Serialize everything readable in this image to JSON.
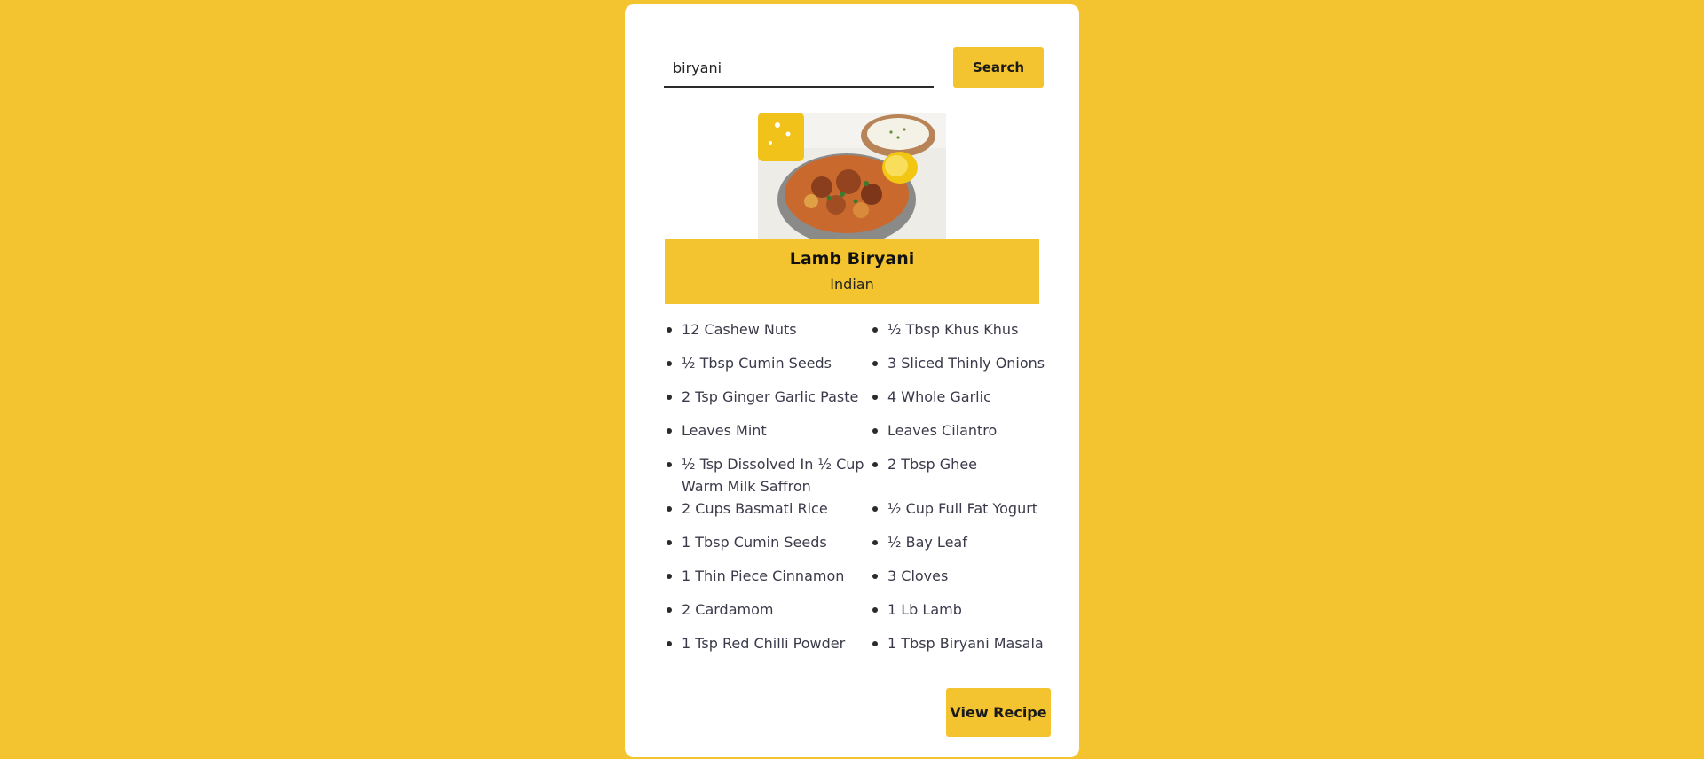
{
  "search": {
    "value": "biryani",
    "button_label": "Search"
  },
  "meal": {
    "image_alt": "Lamb Biryani dish photo",
    "title": "Lamb Biryani",
    "area": "Indian"
  },
  "ingredients": [
    "12 Cashew Nuts",
    "½ Tbsp Khus Khus",
    "½ Tbsp Cumin Seeds",
    "3 Sliced Thinly Onions",
    "2 Tsp Ginger Garlic Paste",
    "4 Whole Garlic",
    "Leaves Mint",
    "Leaves Cilantro",
    "½ Tsp Dissolved In ½ Cup Warm Milk Saffron",
    "2 Tbsp Ghee",
    "2 Cups Basmati Rice",
    "½ Cup Full Fat Yogurt",
    "1 Tbsp Cumin Seeds",
    "½ Bay Leaf",
    "1 Thin Piece Cinnamon",
    "3 Cloves",
    "2 Cardamom",
    "1 Lb Lamb",
    "1 Tsp Red Chilli Powder",
    "1 Tbsp Biryani Masala"
  ],
  "actions": {
    "view_recipe_label": "View Recipe"
  },
  "colors": {
    "accent": "#f4c430",
    "card": "#ffffff"
  }
}
